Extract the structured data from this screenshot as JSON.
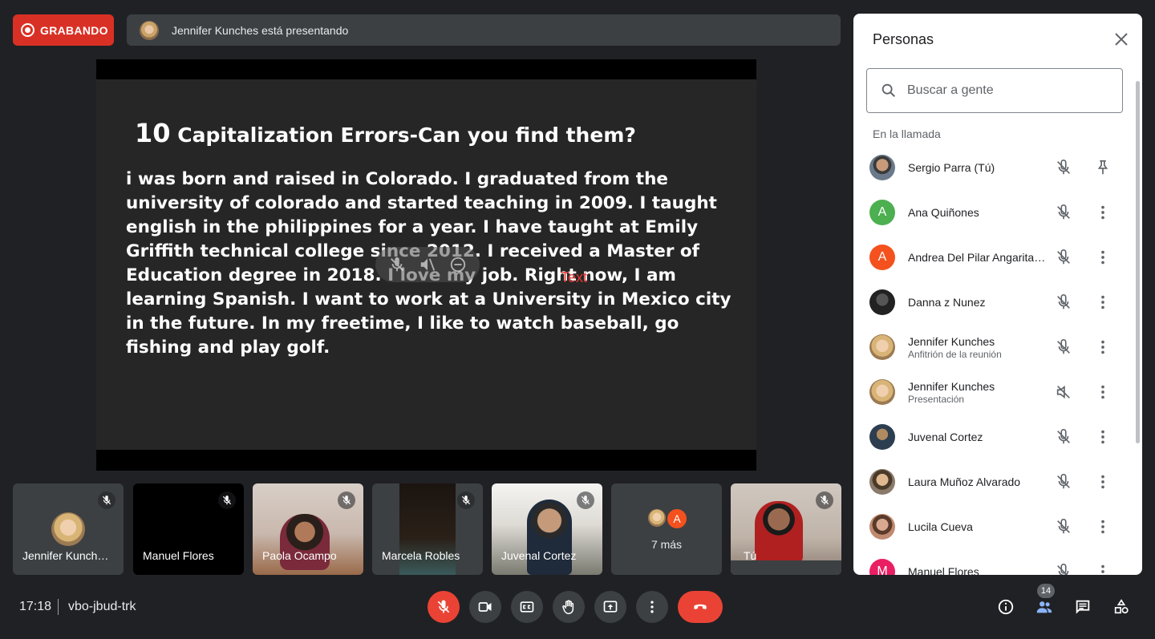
{
  "recording": {
    "label": "GRABANDO"
  },
  "presenting": {
    "text": "Jennifer Kunches está presentando"
  },
  "slide": {
    "title_number": "10",
    "title_text": " Capitalization Errors-Can you find them?",
    "body": "i was born and raised in Colorado. I graduated from the university of colorado and started teaching in 2009. I taught english in the philippines for a year. I have taught at Emily Griffith technical college since 2012. I received a Master of Education degree in 2018. I love my job. Right now, I am learning Spanish. I want to work at a University in Mexico city in the future. In my freetime, I like to watch baseball, go fishing and play golf.",
    "overlay_text": "Text"
  },
  "tiles": [
    {
      "name": "Jennifer Kunch…"
    },
    {
      "name": "Manuel Flores"
    },
    {
      "name": "Paola Ocampo"
    },
    {
      "name": "Marcela Robles"
    },
    {
      "name": "Juvenal Cortez"
    },
    {
      "name": "7 más",
      "avatar_letter": "A"
    },
    {
      "name": "Tú"
    }
  ],
  "bottom": {
    "time": "17:18",
    "meeting_code": "vbo-jbud-trk",
    "participants_count": "14"
  },
  "panel": {
    "title": "Personas",
    "search_placeholder": "Buscar a gente",
    "section_label": "En la llamada",
    "people": [
      {
        "name": "Sergio Parra (Tú)",
        "sub": "",
        "avatar": "photo",
        "color": "#5f6368"
      },
      {
        "name": "Ana Quiñones",
        "sub": "",
        "avatar": "A",
        "color": "#4caf50"
      },
      {
        "name": "Andrea Del Pilar Angarita …",
        "sub": "",
        "avatar": "A",
        "color": "#f4511e"
      },
      {
        "name": "Danna z Nunez",
        "sub": "",
        "avatar": "photo",
        "color": "#3c3c3c"
      },
      {
        "name": "Jennifer Kunches",
        "sub": "Anfitrión de la reunión",
        "avatar": "photo",
        "color": "#c9a36a"
      },
      {
        "name": "Jennifer Kunches",
        "sub": "Presentación",
        "avatar": "photo",
        "color": "#c9a36a"
      },
      {
        "name": "Juvenal Cortez",
        "sub": "",
        "avatar": "photo",
        "color": "#2c3e50"
      },
      {
        "name": "Laura Muñoz Alvarado",
        "sub": "",
        "avatar": "photo",
        "color": "#a08060"
      },
      {
        "name": "Lucila Cueva",
        "sub": "",
        "avatar": "photo",
        "color": "#c08a70"
      },
      {
        "name": "Manuel Flores",
        "sub": "",
        "avatar": "M",
        "color": "#e91e63"
      }
    ]
  },
  "colors": {
    "accent_red": "#ea4335",
    "record_red": "#d93025",
    "background": "#202124",
    "tile": "#3c4043"
  }
}
